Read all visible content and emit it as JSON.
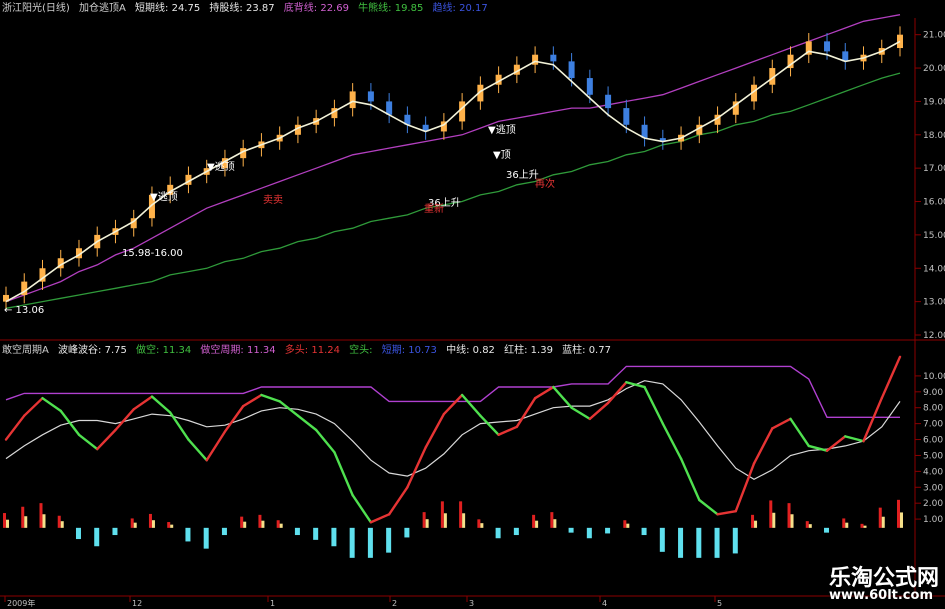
{
  "colors": {
    "bg": "#000000",
    "rise": "#ffb24a",
    "fall": "#3d7fe0",
    "ma_short": "#f2f2d8",
    "ma_white": "#d8d8d8",
    "ma_purple": "#b23fbf",
    "ma_green": "#2f9a3a",
    "ma_gray": "#8a8a8a",
    "osc_up": "#e63434",
    "osc_down": "#4fe04f",
    "osc_purple": "#b040d0",
    "hist_red": "#e02020",
    "hist_yellow": "#f6e08a",
    "hist_cyan": "#5fe0ee",
    "grid": "#8b0000",
    "axis_text": "#c0c0c0"
  },
  "top_header": [
    {
      "text": "浙江阳光(日线)",
      "color": "#cfcfcf"
    },
    {
      "text": "加仓逃顶A",
      "color": "#cfcfcf"
    },
    {
      "text": "短期线: 24.75",
      "color": "#e8e8e8"
    },
    {
      "text": "持股线: 23.87",
      "color": "#e8e8e8"
    },
    {
      "text": "底背线: 22.69",
      "color": "#d060d0"
    },
    {
      "text": "牛熊线: 19.85",
      "color": "#40c040"
    },
    {
      "text": "趋线: 20.17",
      "color": "#3b54e0"
    }
  ],
  "osc_header": [
    {
      "text": "敢空周期A",
      "color": "#cfcfcf"
    },
    {
      "text": "波峰波谷: 7.75",
      "color": "#e8e8e8"
    },
    {
      "text": "做空: 11.34",
      "color": "#40c040"
    },
    {
      "text": "做空周期: 11.34",
      "color": "#d060d0"
    },
    {
      "text": "多头: 11.24",
      "color": "#e63434"
    },
    {
      "text": "空头:",
      "color": "#40c040"
    },
    {
      "text": "短期: 10.73",
      "color": "#3b54e0"
    },
    {
      "text": "中线: 0.82",
      "color": "#e8e8e8"
    },
    {
      "text": "红柱: 1.39",
      "color": "#e8e8e8"
    },
    {
      "text": "蓝柱: 0.77",
      "color": "#e8e8e8"
    }
  ],
  "price_axis": [
    "21.00",
    "20.00",
    "19.00",
    "18.00",
    "17.00",
    "16.00",
    "15.00",
    "14.00",
    "13.00",
    "12.00"
  ],
  "osc_axis": [
    "10.00",
    "9.00",
    "8.00",
    "7.00",
    "6.00",
    "5.00",
    "4.00",
    "3.00",
    "2.00",
    "1.00"
  ],
  "date_axis": [
    "2009年",
    "12",
    "1",
    "2",
    "3",
    "4",
    "5"
  ],
  "annotations": {
    "escape_top": "▼逃顶",
    "top": "▼顶",
    "rise": "36上升",
    "range": "15.98-16.00",
    "low": "← 13.06",
    "sell": "卖卖",
    "buy": "重新",
    "double": "再次"
  },
  "watermark": {
    "title": "乐淘公式网",
    "url": "www.60lt.com"
  },
  "chart_data": {
    "type": "candlestick",
    "title": "浙江阳光(日线)",
    "price_range": [
      12,
      21.5
    ],
    "osc_range": [
      0,
      11
    ],
    "series": [
      {
        "name": "K线",
        "values": [
          13.2,
          13.6,
          14.0,
          14.3,
          14.6,
          15.0,
          15.2,
          15.5,
          16.2,
          16.5,
          16.8,
          17.0,
          17.3,
          17.6,
          17.8,
          18.0,
          18.3,
          18.5,
          18.8,
          19.3,
          19.0,
          18.6,
          18.3,
          18.1,
          18.4,
          19.0,
          19.5,
          19.8,
          20.1,
          20.4,
          20.2,
          19.7,
          19.2,
          18.8,
          18.3,
          17.9,
          17.8,
          18.0,
          18.3,
          18.6,
          19.0,
          19.5,
          20.0,
          20.4,
          20.8,
          20.5,
          20.2,
          20.4,
          20.6,
          21.0
        ]
      },
      {
        "name": "短期线",
        "values": [
          13.0,
          13.3,
          13.7,
          14.1,
          14.4,
          14.8,
          15.1,
          15.4,
          15.9,
          16.3,
          16.6,
          16.9,
          17.2,
          17.5,
          17.7,
          17.9,
          18.2,
          18.4,
          18.7,
          19.0,
          18.9,
          18.6,
          18.3,
          18.1,
          18.3,
          18.8,
          19.3,
          19.6,
          19.9,
          20.2,
          20.1,
          19.6,
          19.1,
          18.6,
          18.2,
          17.9,
          17.8,
          17.9,
          18.2,
          18.5,
          18.9,
          19.3,
          19.7,
          20.1,
          20.5,
          20.4,
          20.2,
          20.3,
          20.5,
          20.8
        ]
      },
      {
        "name": "底背线",
        "values": [
          13.0,
          13.2,
          13.4,
          13.6,
          13.9,
          14.1,
          14.4,
          14.6,
          14.9,
          15.2,
          15.5,
          15.8,
          16.0,
          16.2,
          16.4,
          16.6,
          16.8,
          17.0,
          17.2,
          17.4,
          17.5,
          17.6,
          17.7,
          17.8,
          17.9,
          18.0,
          18.2,
          18.4,
          18.5,
          18.6,
          18.7,
          18.8,
          18.8,
          18.9,
          19.0,
          19.1,
          19.2,
          19.4,
          19.6,
          19.8,
          20.0,
          20.2,
          20.4,
          20.6,
          20.8,
          21.0,
          21.2,
          21.4,
          21.5,
          21.6
        ]
      },
      {
        "name": "牛熊线",
        "values": [
          12.8,
          12.9,
          13.0,
          13.1,
          13.2,
          13.3,
          13.4,
          13.5,
          13.6,
          13.8,
          13.9,
          14.0,
          14.2,
          14.3,
          14.5,
          14.6,
          14.8,
          14.9,
          15.1,
          15.2,
          15.4,
          15.5,
          15.6,
          15.8,
          15.9,
          16.0,
          16.2,
          16.3,
          16.5,
          16.6,
          16.8,
          16.9,
          17.1,
          17.2,
          17.4,
          17.5,
          17.7,
          17.8,
          18.0,
          18.1,
          18.3,
          18.4,
          18.6,
          18.7,
          18.9,
          19.1,
          19.3,
          19.5,
          19.7,
          19.85
        ]
      },
      {
        "name": "波峰波谷",
        "values": [
          6.0,
          7.5,
          8.6,
          7.8,
          6.3,
          5.4,
          6.6,
          7.9,
          8.7,
          7.7,
          6.0,
          4.7,
          6.5,
          8.1,
          8.8,
          8.4,
          7.5,
          6.6,
          5.2,
          2.5,
          0.8,
          1.3,
          3.0,
          5.5,
          7.6,
          8.8,
          7.5,
          6.3,
          6.8,
          8.6,
          9.3,
          8.0,
          7.3,
          8.3,
          9.6,
          9.3,
          7.0,
          4.8,
          2.2,
          1.3,
          1.5,
          4.5,
          6.7,
          7.3,
          5.6,
          5.3,
          6.2,
          5.9,
          8.6,
          11.2
        ]
      },
      {
        "name": "做空周期",
        "values": [
          8.5,
          8.9,
          8.9,
          8.9,
          8.9,
          8.9,
          8.9,
          8.9,
          8.9,
          8.9,
          8.9,
          8.9,
          8.9,
          8.9,
          9.3,
          9.3,
          9.3,
          9.3,
          9.3,
          9.3,
          9.3,
          8.4,
          8.4,
          8.4,
          8.4,
          8.4,
          8.4,
          9.3,
          9.3,
          9.3,
          9.3,
          9.5,
          9.5,
          9.5,
          10.6,
          10.6,
          10.6,
          10.6,
          10.6,
          10.6,
          10.6,
          10.6,
          10.6,
          10.6,
          9.8,
          7.4,
          7.4,
          7.4,
          7.4,
          7.4
        ]
      },
      {
        "name": "中线",
        "values": [
          4.8,
          5.6,
          6.3,
          6.9,
          7.2,
          7.2,
          7.0,
          7.3,
          7.6,
          7.5,
          7.2,
          6.8,
          6.9,
          7.3,
          7.8,
          8.0,
          7.9,
          7.6,
          7.0,
          5.9,
          4.7,
          3.9,
          3.7,
          4.2,
          5.1,
          6.3,
          7.0,
          7.1,
          7.2,
          7.6,
          8.0,
          8.1,
          8.1,
          8.5,
          9.2,
          9.7,
          9.5,
          8.5,
          7.1,
          5.6,
          4.2,
          3.5,
          4.1,
          5.0,
          5.3,
          5.4,
          5.6,
          5.9,
          6.8,
          8.4
        ]
      }
    ]
  }
}
